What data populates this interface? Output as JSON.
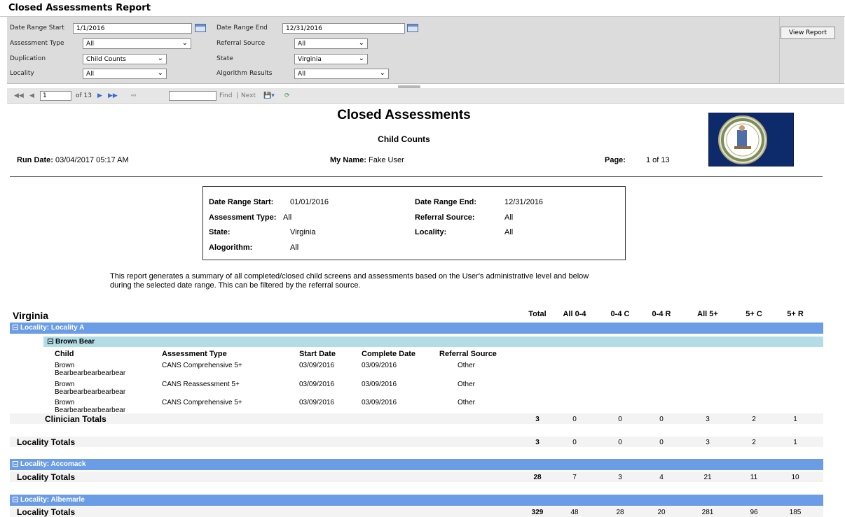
{
  "window": {
    "title": "Closed Assessments Report"
  },
  "params": {
    "date_start_label": "Date Range Start",
    "date_start_value": "1/1/2016",
    "date_end_label": "Date Range End",
    "date_end_value": "12/31/2016",
    "assessment_type_label": "Assessment Type",
    "assessment_type_value": "All",
    "referral_source_label": "Referral Source",
    "referral_source_value": "All",
    "duplication_label": "Duplication",
    "duplication_value": "Child Counts",
    "state_label": "State",
    "state_value": "Virginia",
    "locality_label": "Locality",
    "locality_value": "All",
    "algorithm_label": "Algorithm Results",
    "algorithm_value": "All",
    "view_button": "View Report"
  },
  "toolbar": {
    "page_value": "1",
    "of_pages": "of 13",
    "find_label": "Find",
    "sep": "|",
    "next_label": "Next"
  },
  "report": {
    "title": "Closed Assessments",
    "subtitle": "Child Counts",
    "run_date_label": "Run Date:",
    "run_date_value": "03/04/2017  05:17 AM",
    "my_name_label": "My Name:",
    "my_name_value": "Fake User",
    "page_label": "Page:",
    "page_value": "1 of 13",
    "filters": {
      "date_start_label": "Date Range Start:",
      "date_start_value": "01/01/2016",
      "date_end_label": "Date Range End:",
      "date_end_value": "12/31/2016",
      "assessment_type_label": "Assessment Type:",
      "assessment_type_value": "All",
      "referral_source_label": "Referral Source:",
      "referral_source_value": "All",
      "state_label": "State:",
      "state_value": "Virginia",
      "locality_label": "Locality:",
      "locality_value": "All",
      "algorithm_label": "Alogorithm:",
      "algorithm_value": "All"
    },
    "description_1": "This report generates a summary of all completed/closed child screens and assessments based on the User's administrative level and below",
    "description_2": "during the selected date range.  This can be filtered by the referral source.",
    "state_heading": "Virginia",
    "columns": [
      "Total",
      "All 0-4",
      "0-4 C",
      "0-4 R",
      "All 5+",
      "5+ C",
      "5+ R"
    ],
    "detail_headers": [
      "Child",
      "Assessment Type",
      "Start Date",
      "Complete Date",
      "Referral Source"
    ],
    "locality_prefix": "Locality:",
    "localities": [
      {
        "name": "Locality A"
      },
      {
        "name": "Accomack"
      },
      {
        "name": "Albemarle"
      }
    ],
    "clinician": "Brown Bear",
    "rows": [
      {
        "child_1": "Brown",
        "child_2": "Bearbearbearbearbear",
        "type": "CANS Comprehensive 5+",
        "start": "03/09/2016",
        "complete": "03/09/2016",
        "source": "Other"
      },
      {
        "child_1": "Brown",
        "child_2": "Bearbearbearbearbear",
        "type": "CANS Reassessment 5+",
        "start": "03/09/2016",
        "complete": "03/09/2016",
        "source": "Other"
      },
      {
        "child_1": "Brown",
        "child_2": "Bearbearbearbearbear",
        "type": "CANS Comprehensive 5+",
        "start": "03/09/2016",
        "complete": "03/09/2016",
        "source": "Other"
      }
    ],
    "clinician_totals_label": "Clinician Totals",
    "locality_totals_label": "Locality Totals",
    "clinician_totals": [
      "3",
      "0",
      "0",
      "0",
      "3",
      "2",
      "1"
    ],
    "locality_a_totals": [
      "3",
      "0",
      "0",
      "0",
      "3",
      "2",
      "1"
    ],
    "accomack_totals": [
      "28",
      "7",
      "3",
      "4",
      "21",
      "11",
      "10"
    ],
    "albemarle_totals": [
      "329",
      "48",
      "28",
      "20",
      "281",
      "96",
      "185"
    ]
  }
}
